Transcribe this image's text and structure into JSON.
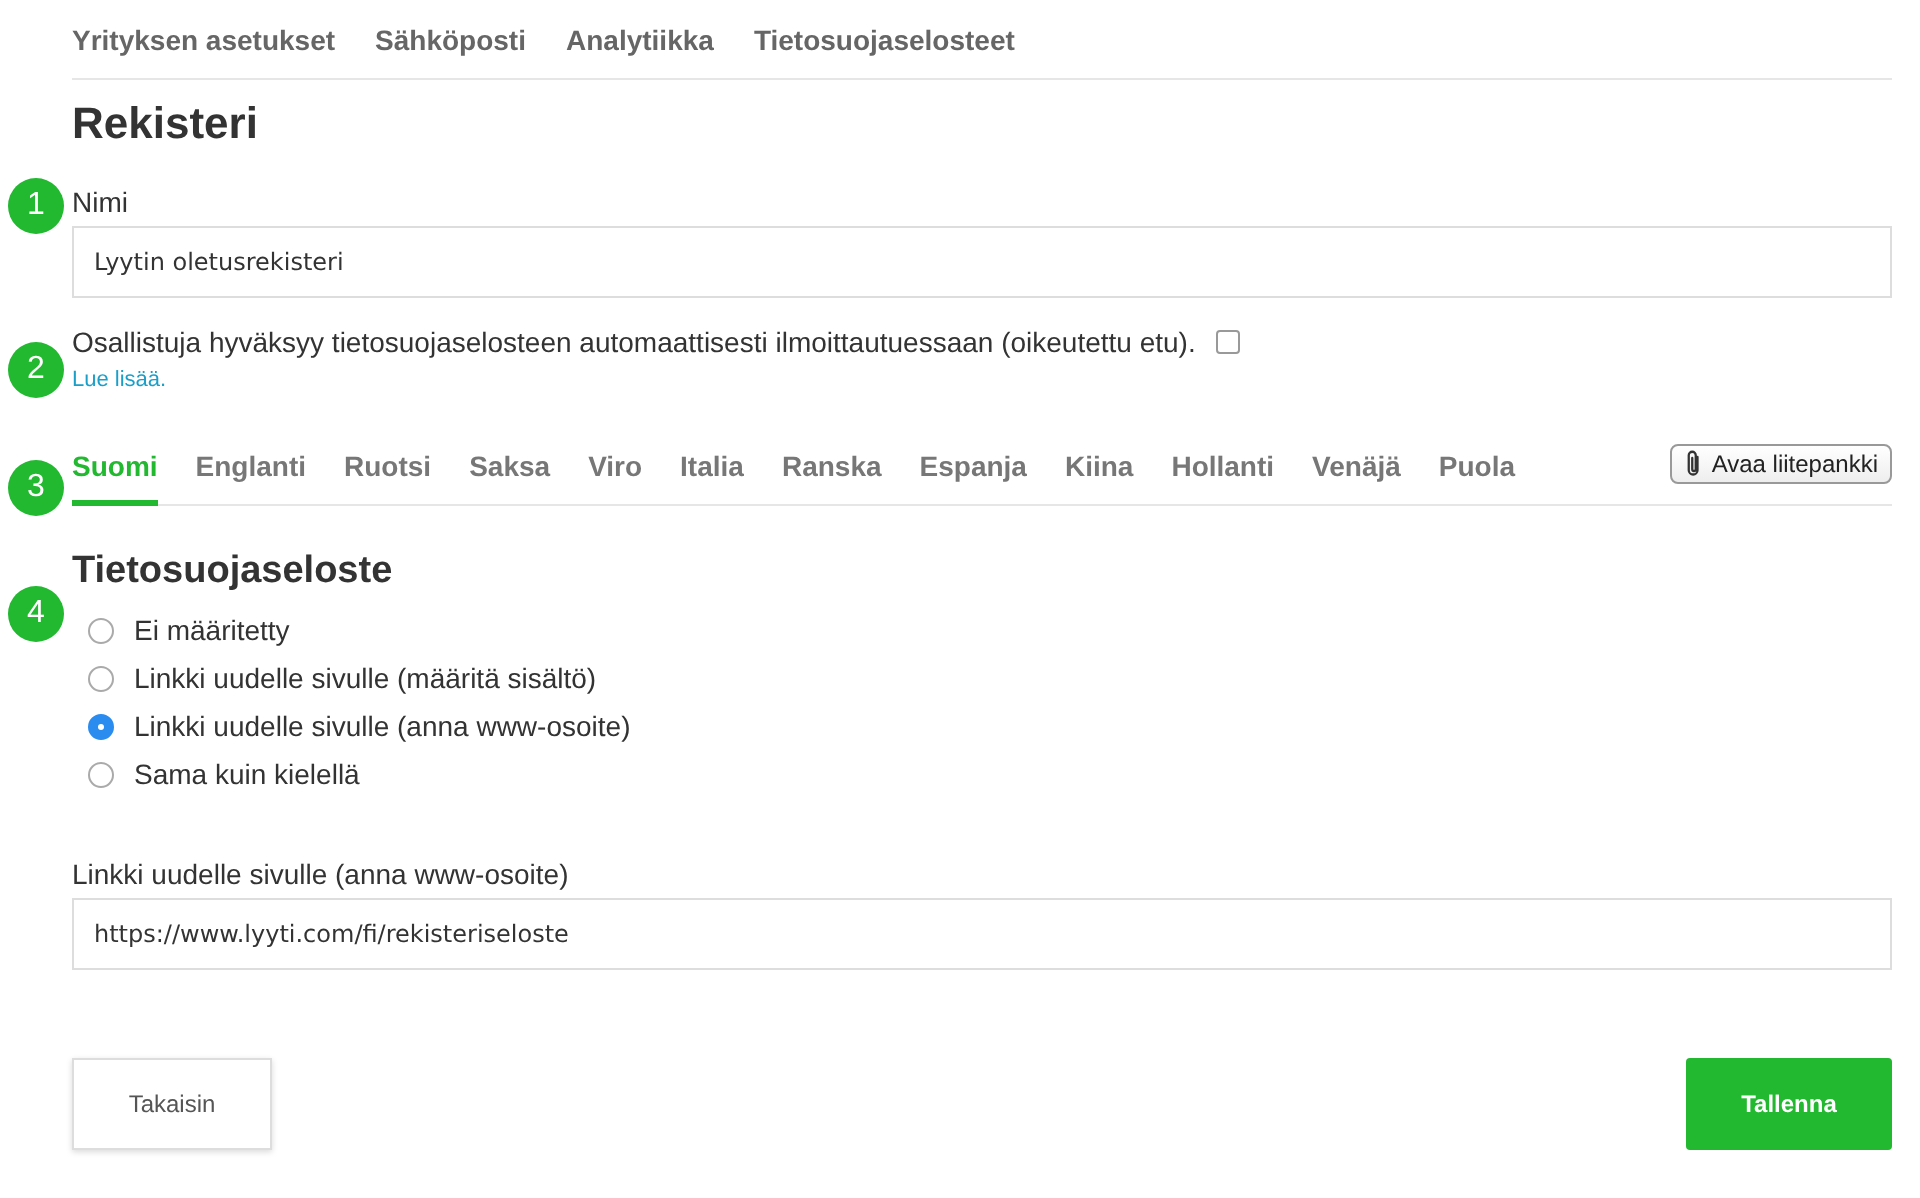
{
  "top_nav": [
    {
      "label": "Yrityksen asetukset"
    },
    {
      "label": "Sähköposti"
    },
    {
      "label": "Analytiikka"
    },
    {
      "label": "Tietosuojaselosteet"
    }
  ],
  "title": "Rekisteri",
  "name_field": {
    "marker": "1",
    "label": "Nimi",
    "value": "Lyytin oletusrekisteri"
  },
  "consent": {
    "marker": "2",
    "text": "Osallistuja hyväksyy tietosuojaselosteen automaattisesti ilmoittautuessaan (oikeutettu etu).",
    "checked": false,
    "link": "Lue lisää."
  },
  "language_tabs": {
    "marker": "3",
    "tabs": [
      {
        "label": "Suomi",
        "selected": true
      },
      {
        "label": "Englanti",
        "selected": false
      },
      {
        "label": "Ruotsi",
        "selected": false
      },
      {
        "label": "Saksa",
        "selected": false
      },
      {
        "label": "Viro",
        "selected": false
      },
      {
        "label": "Italia",
        "selected": false
      },
      {
        "label": "Ranska",
        "selected": false
      },
      {
        "label": "Espanja",
        "selected": false
      },
      {
        "label": "Kiina",
        "selected": false
      },
      {
        "label": "Hollanti",
        "selected": false
      },
      {
        "label": "Venäjä",
        "selected": false
      },
      {
        "label": "Puola",
        "selected": false
      }
    ],
    "attachment_button": "Avaa liitepankki"
  },
  "privacy": {
    "marker": "4",
    "title": "Tietosuojaseloste",
    "options": [
      {
        "label": "Ei määritetty",
        "selected": false
      },
      {
        "label": "Linkki uudelle sivulle (määritä sisältö)",
        "selected": false
      },
      {
        "label": "Linkki uudelle sivulle (anna www-osoite)",
        "selected": true
      },
      {
        "label": "Sama kuin kielellä",
        "selected": false
      }
    ],
    "url_field": {
      "label": "Linkki uudelle sivulle (anna www-osoite)",
      "value": "https://www.lyyti.com/fi/rekisteriseloste"
    }
  },
  "buttons": {
    "back": "Takaisin",
    "save": "Tallenna"
  }
}
